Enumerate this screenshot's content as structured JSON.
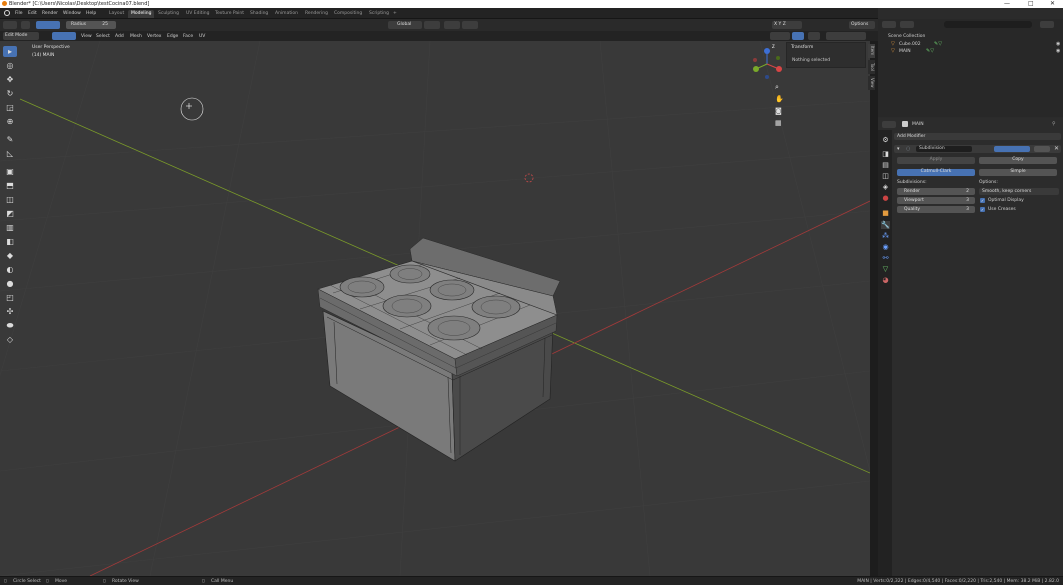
{
  "window": {
    "title": "Blender* [C:\\Users\\Nicolas\\Desktop\\testCocina07.blend]",
    "minimize": "—",
    "maximize": "□",
    "close": "✕"
  },
  "menubar": {
    "items": [
      "File",
      "Edit",
      "Render",
      "Window",
      "Help"
    ],
    "workspaces": [
      "Layout",
      "Modeling",
      "Sculpting",
      "UV Editing",
      "Texture Paint",
      "Shading",
      "Animation",
      "Rendering",
      "Compositing",
      "Scripting"
    ],
    "active_workspace": "Modeling",
    "add_workspace": "+",
    "scene_label": "Scene",
    "view_layer_label": "View Layer"
  },
  "tool_header": {
    "radius_label": "Radius",
    "radius_value": "25",
    "orientation": "Global",
    "options_label": "Options"
  },
  "mode_header": {
    "mode": "Edit Mode",
    "menus": [
      "View",
      "Select",
      "Add",
      "Mesh",
      "Vertex",
      "Edge",
      "Face",
      "UV"
    ],
    "axes": [
      "X",
      "Y",
      "Z"
    ]
  },
  "viewport": {
    "perspective_label": "User Perspective",
    "object_label": "(14) MAIN",
    "gizmo_axes": {
      "x": "X",
      "y": "Y",
      "z": "Z"
    },
    "colors": {
      "background": "#393939",
      "x_axis": "#a33a3a",
      "y_axis": "#7a9a2a",
      "selection": "#4772b3"
    }
  },
  "npanel": {
    "header": "Transform",
    "message": "Nothing selected",
    "tabs": [
      "Item",
      "Tool",
      "View"
    ]
  },
  "outliner": {
    "search_placeholder": "",
    "collection": "Scene Collection",
    "items": [
      {
        "name": "Cube.002"
      },
      {
        "name": "MAIN"
      }
    ]
  },
  "properties": {
    "object_name": "MAIN",
    "add_modifier": "Add Modifier",
    "modifier": {
      "name": "Subdivision",
      "apply": "Apply",
      "copy": "Copy",
      "catmull": "Catmull-Clark",
      "simple": "Simple",
      "subdivisions_label": "Subdivisions:",
      "render_label": "Render",
      "render_value": "2",
      "viewport_label": "Viewport",
      "viewport_value": "3",
      "quality_label": "Quality",
      "quality_value": "3",
      "options_label": "Options:",
      "uv_option": "Smooth, keep corners",
      "optimal_display": "Optimal Display",
      "use_creases": "Use Creases"
    }
  },
  "status": {
    "circle_select": "Circle Select",
    "move": "Move",
    "rotate_view": "Rotate View",
    "call_menu": "Call Menu",
    "stats": "MAIN | Verts:0/2,322 | Edges:0/4,540 | Faces:0/2,220 | Tris:2,540 | Mem: 38.2 MiB | 2.82.0"
  }
}
